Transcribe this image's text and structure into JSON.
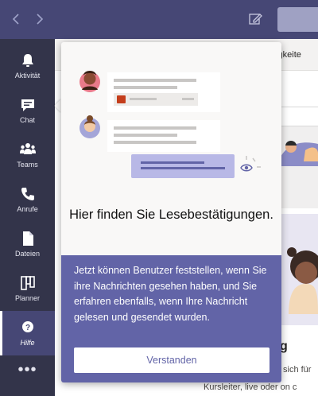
{
  "titlebar": {
    "back_icon": "arrow-left-icon",
    "forward_icon": "arrow-right-icon",
    "compose_icon": "compose-icon"
  },
  "rail": {
    "items": [
      {
        "label": "Aktivität",
        "icon": "bell-icon"
      },
      {
        "label": "Chat",
        "icon": "chat-icon"
      },
      {
        "label": "Teams",
        "icon": "teams-icon"
      },
      {
        "label": "Anrufe",
        "icon": "phone-icon"
      },
      {
        "label": "Dateien",
        "icon": "file-icon"
      },
      {
        "label": "Planner",
        "icon": "planner-icon"
      },
      {
        "label": "Hilfe",
        "icon": "help-icon"
      }
    ],
    "more": "•••",
    "active_index": 6
  },
  "main": {
    "header_text": "uigkeite",
    "card_title": "g",
    "line1": "sich für",
    "line2": "Kursleiter, live oder on c"
  },
  "popup": {
    "heading": "Hier finden Sie Lesebestätigungen.",
    "body": "Jetzt können Benutzer feststellen, wenn Sie ihre Nachrichten gesehen haben, und Sie erfahren ebenfalls, wenn Ihre Nachricht gelesen und gesendet wurden.",
    "button_label": "Verstanden"
  },
  "colors": {
    "brand": "#6264a7",
    "titlebar": "#464775",
    "rail": "#33344a"
  }
}
